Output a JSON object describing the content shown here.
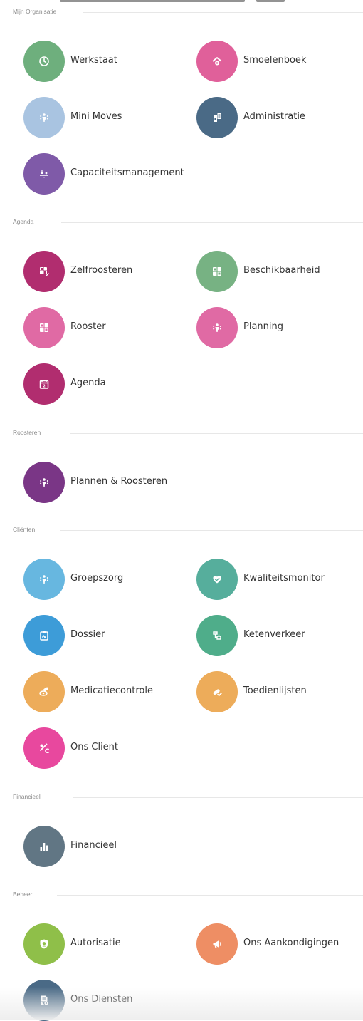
{
  "sections": [
    {
      "title": "Mijn Organisatie",
      "items": [
        {
          "label": "Werkstaat",
          "icon": "clock-icon",
          "color": "#6eaf7d"
        },
        {
          "label": "Smoelenboek",
          "icon": "house-person-icon",
          "color": "#e0609a"
        },
        {
          "label": "Mini Moves",
          "icon": "people-icon",
          "color": "#a9c4e1"
        },
        {
          "label": "Administratie",
          "icon": "document-building-icon",
          "color": "#4a6a86"
        },
        {
          "label": "Capaciteitsmanagement",
          "icon": "balance-icon",
          "color": "#7f5aa8"
        }
      ]
    },
    {
      "title": "Agenda",
      "items": [
        {
          "label": "Zelfroosteren",
          "icon": "grid-edit-icon",
          "color": "#b12d6f"
        },
        {
          "label": "Beschikbaarheid",
          "icon": "grid-icon",
          "color": "#77b283"
        },
        {
          "label": "Rooster",
          "icon": "grid-icon",
          "color": "#e06aa4"
        },
        {
          "label": "Planning",
          "icon": "people-icon",
          "color": "#e06aa4"
        },
        {
          "label": "Agenda",
          "icon": "calendar-icon",
          "color": "#b12d6f"
        }
      ]
    },
    {
      "title": "Roosteren",
      "items": [
        {
          "label": "Plannen & Roosteren",
          "icon": "people-icon",
          "color": "#7a3686"
        }
      ]
    },
    {
      "title": "Cliënten",
      "items": [
        {
          "label": "Groepszorg",
          "icon": "people-icon",
          "color": "#67b7e0"
        },
        {
          "label": "Kwaliteitsmonitor",
          "icon": "heart-icon",
          "color": "#56ae9c"
        },
        {
          "label": "Dossier",
          "icon": "clipboard-icon",
          "color": "#3d9cd8"
        },
        {
          "label": "Ketenverkeer",
          "icon": "exchange-icon",
          "color": "#4fad8a"
        },
        {
          "label": "Medicatiecontrole",
          "icon": "pill-eye-icon",
          "color": "#edac5a"
        },
        {
          "label": "Toedienlijsten",
          "icon": "pill-check-icon",
          "color": "#edac5a"
        },
        {
          "label": "Ons Client",
          "icon": "percent-c-icon",
          "color": "#e8489e"
        }
      ]
    },
    {
      "title": "Financieel",
      "items": [
        {
          "label": "Financieel",
          "icon": "bar-chart-icon",
          "color": "#617684"
        }
      ]
    },
    {
      "title": "Beheer",
      "items": [
        {
          "label": "Autorisatie",
          "icon": "shield-icon",
          "color": "#8fbf49"
        },
        {
          "label": "Ons Aankondigingen",
          "icon": "megaphone-icon",
          "color": "#ee8e64"
        },
        {
          "label": "Ons Diensten",
          "icon": "document-gear-icon",
          "color": "#4a6a86"
        }
      ]
    }
  ]
}
